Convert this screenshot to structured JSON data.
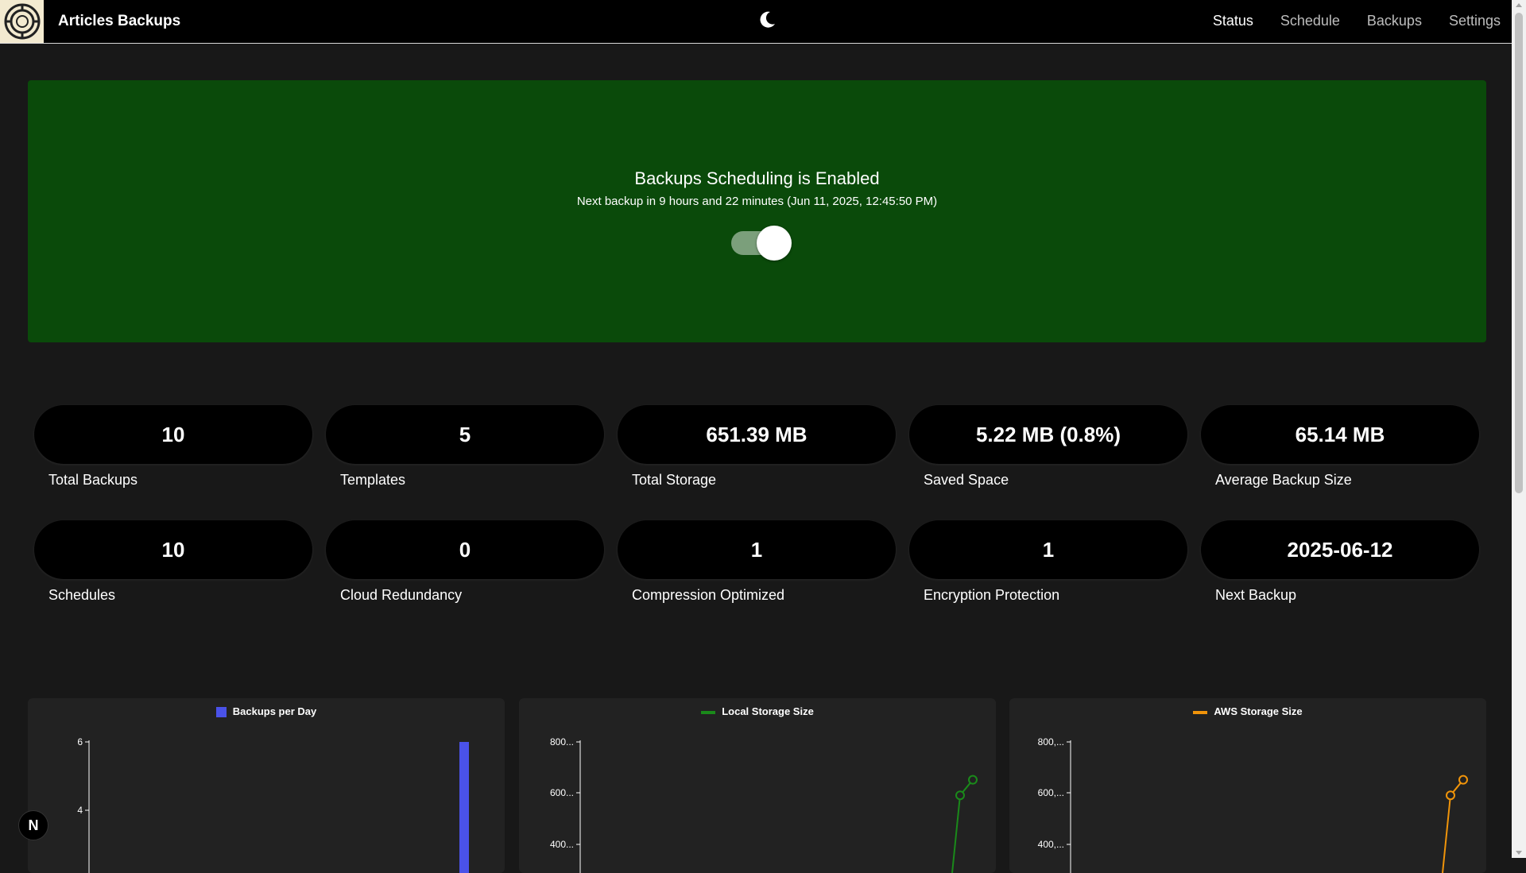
{
  "app": {
    "title": "Articles Backups"
  },
  "nav": {
    "items": [
      {
        "label": "Status",
        "active": true
      },
      {
        "label": "Schedule",
        "active": false
      },
      {
        "label": "Backups",
        "active": false
      },
      {
        "label": "Settings",
        "active": false
      }
    ]
  },
  "banner": {
    "title": "Backups Scheduling is Enabled",
    "subtitle": "Next backup in 9 hours and 22 minutes (Jun 11, 2025, 12:45:50 PM)",
    "enabled": true,
    "color": "#0a4a0a"
  },
  "stats": [
    {
      "value": "10",
      "label": "Total Backups"
    },
    {
      "value": "5",
      "label": "Templates"
    },
    {
      "value": "651.39 MB",
      "label": "Total Storage"
    },
    {
      "value": "5.22 MB (0.8%)",
      "label": "Saved Space"
    },
    {
      "value": "65.14 MB",
      "label": "Average Backup Size"
    },
    {
      "value": "10",
      "label": "Schedules"
    },
    {
      "value": "0",
      "label": "Cloud Redundancy"
    },
    {
      "value": "1",
      "label": "Compression Optimized"
    },
    {
      "value": "1",
      "label": "Encryption Protection"
    },
    {
      "value": "2025-06-12",
      "label": "Next Backup"
    }
  ],
  "badge": {
    "letter": "N"
  },
  "chart_data": [
    {
      "type": "bar",
      "series": [
        {
          "name": "Backups per Day",
          "color": "#4a52e8",
          "values": [
            6
          ]
        }
      ],
      "yticks": [
        "6",
        "4"
      ],
      "ylim": [
        0,
        6
      ]
    },
    {
      "type": "line",
      "series": [
        {
          "name": "Local Storage Size",
          "color": "#1a8a1a",
          "values": [
            590,
            651
          ]
        }
      ],
      "yticks": [
        "800...",
        "600...",
        "400..."
      ],
      "ylim": [
        0,
        800
      ]
    },
    {
      "type": "line",
      "series": [
        {
          "name": "AWS Storage Size",
          "color": "#f0940a",
          "values": [
            590,
            651
          ]
        }
      ],
      "yticks": [
        "800,...",
        "600,...",
        "400,..."
      ],
      "ylim": [
        0,
        800
      ]
    }
  ]
}
